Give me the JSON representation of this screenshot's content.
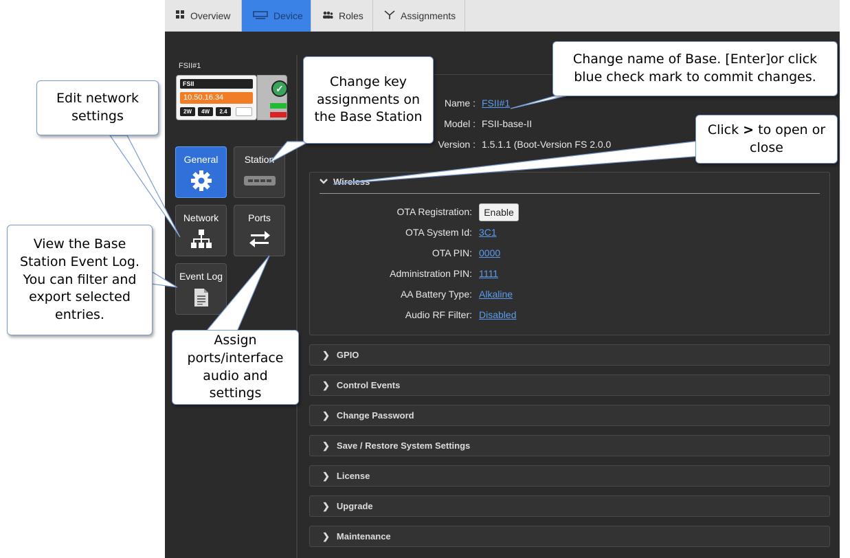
{
  "tabs": [
    {
      "label": "Overview",
      "icon": "grid-icon"
    },
    {
      "label": "Device",
      "icon": "device-icon",
      "active": true
    },
    {
      "label": "Roles",
      "icon": "users-icon"
    },
    {
      "label": "Assignments",
      "icon": "assignments-icon"
    }
  ],
  "base_station": {
    "label": "FSII#1",
    "model_badge": "FSII",
    "ip": "10.50.16.34",
    "chips": [
      "2W",
      "4W",
      "2.4"
    ]
  },
  "nav": {
    "general": "General",
    "station": "Station",
    "network": "Network",
    "ports": "Ports",
    "event_log": "Event Log"
  },
  "details": {
    "name_label": "Name :",
    "name_value": "FSII#1",
    "model_label": "Model :",
    "model_value": "FSII-base-II",
    "version_label": "Version :",
    "version_value": "1.5.1.1 (Boot-Version FS 2.0.0"
  },
  "wireless": {
    "title": "Wireless",
    "rows": [
      {
        "label": "OTA Registration:",
        "value": "Enable",
        "kind": "button"
      },
      {
        "label": "OTA System Id:",
        "value": "3C1"
      },
      {
        "label": "OTA PIN:",
        "value": "0000"
      },
      {
        "label": "Administration PIN:",
        "value": "1111"
      },
      {
        "label": "AA Battery Type:",
        "value": "Alkaline"
      },
      {
        "label": "Audio RF Filter:",
        "value": "Disabled"
      }
    ]
  },
  "sections": [
    "GPIO",
    "Control Events",
    "Change Password",
    "Save / Restore System Settings",
    "License",
    "Upgrade",
    "Maintenance"
  ],
  "callouts": {
    "network": "Edit network settings",
    "station": "Change key assignments on the Base Station",
    "name": "Change name of Base. [Enter]or click blue check mark to commit changes.",
    "toggle_pre": "Click",
    "toggle_symbol": ">",
    "toggle_post": "to open or close",
    "event_log": "View the Base Station Event Log. You can filter and export selected entries.",
    "ports": "Assign ports/interface audio and settings"
  },
  "colors": {
    "accent": "#3170d8",
    "link": "#5b9cf0",
    "ip_badge": "#f07e26",
    "background": "#2b2b2b"
  }
}
